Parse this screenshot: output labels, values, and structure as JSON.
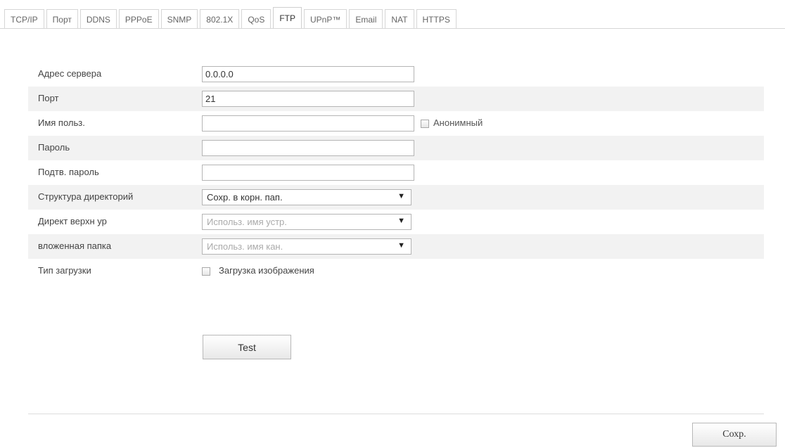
{
  "tabs": [
    "TCP/IP",
    "Порт",
    "DDNS",
    "PPPoE",
    "SNMP",
    "802.1X",
    "QoS",
    "FTP",
    "UPnP™",
    "Email",
    "NAT",
    "HTTPS"
  ],
  "active_tab": "FTP",
  "form": {
    "server_address": {
      "label": "Адрес сервера",
      "value": "0.0.0.0"
    },
    "port": {
      "label": "Порт",
      "value": "21"
    },
    "username": {
      "label": "Имя польз.",
      "value": "",
      "anonymous_label": "Анонимный"
    },
    "password": {
      "label": "Пароль",
      "value": ""
    },
    "confirm_password": {
      "label": "Подтв. пароль",
      "value": ""
    },
    "dir_structure": {
      "label": "Структура директорий",
      "value": "Сохр. в корн. пап."
    },
    "parent_dir": {
      "label": "Директ верхн ур",
      "value": "Использ. имя устр."
    },
    "child_dir": {
      "label": "вложенная папка",
      "value": "Использ. имя кан."
    },
    "upload_type": {
      "label": "Тип загрузки",
      "option_label": "Загрузка изображения"
    }
  },
  "buttons": {
    "test": "Test",
    "save": "Сохр."
  },
  "icons": {
    "dropdown_arrow": "▼"
  }
}
